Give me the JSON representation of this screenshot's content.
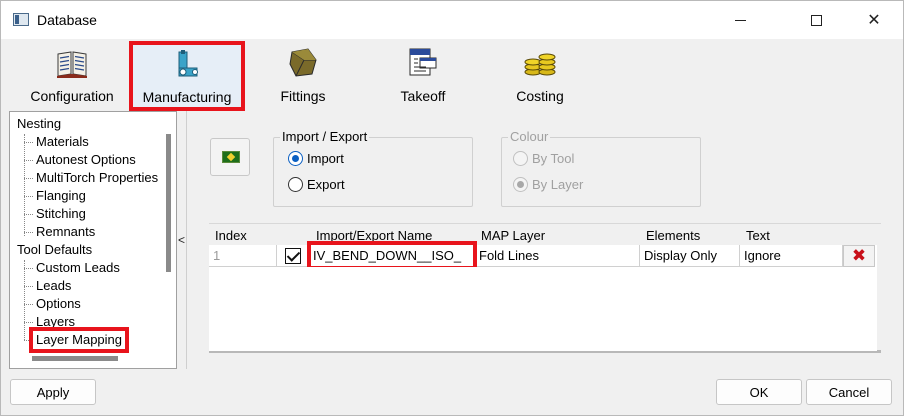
{
  "window": {
    "title": "Database"
  },
  "ribbon": {
    "tabs": [
      {
        "label": "Configuration",
        "icon": "book-icon"
      },
      {
        "label": "Manufacturing",
        "icon": "manufacturing-icon",
        "selected": true
      },
      {
        "label": "Fittings",
        "icon": "fittings-icon"
      },
      {
        "label": "Takeoff",
        "icon": "takeoff-icon"
      },
      {
        "label": "Costing",
        "icon": "coins-icon"
      }
    ]
  },
  "tree": {
    "items": [
      {
        "label": "Nesting",
        "level": 0
      },
      {
        "label": "Materials",
        "level": 1
      },
      {
        "label": "Autonest Options",
        "level": 1
      },
      {
        "label": "MultiTorch Properties",
        "level": 1
      },
      {
        "label": "Flanging",
        "level": 1
      },
      {
        "label": "Stitching",
        "level": 1
      },
      {
        "label": "Remnants",
        "level": 1
      },
      {
        "label": "Tool Defaults",
        "level": 0
      },
      {
        "label": "Custom Leads",
        "level": 1
      },
      {
        "label": "Leads",
        "level": 1
      },
      {
        "label": "Options",
        "level": 1
      },
      {
        "label": "Layers",
        "level": 1
      },
      {
        "label": "Layer Mapping",
        "level": 1,
        "selected": true
      }
    ],
    "collapse_glyph": "<"
  },
  "import_export": {
    "title": "Import / Export",
    "options": [
      "Import",
      "Export"
    ],
    "selected": "Import"
  },
  "colour": {
    "title": "Colour",
    "options": [
      "By Tool",
      "By Layer"
    ],
    "selected": "By Layer",
    "disabled": true
  },
  "grid": {
    "headers": [
      "Index",
      "Import/Export Name",
      "MAP Layer",
      "Elements",
      "Text"
    ],
    "rows": [
      {
        "index": "1",
        "checked": true,
        "name": "IV_BEND_DOWN__ISO_",
        "map_layer": "Fold Lines",
        "elements": "Display Only",
        "text": "Ignore"
      }
    ]
  },
  "footer": {
    "apply": "Apply",
    "ok": "OK",
    "cancel": "Cancel"
  },
  "colors": {
    "highlight": "#e8141c",
    "radio_accent": "#0a5fc2",
    "delete": "#c8101a"
  }
}
